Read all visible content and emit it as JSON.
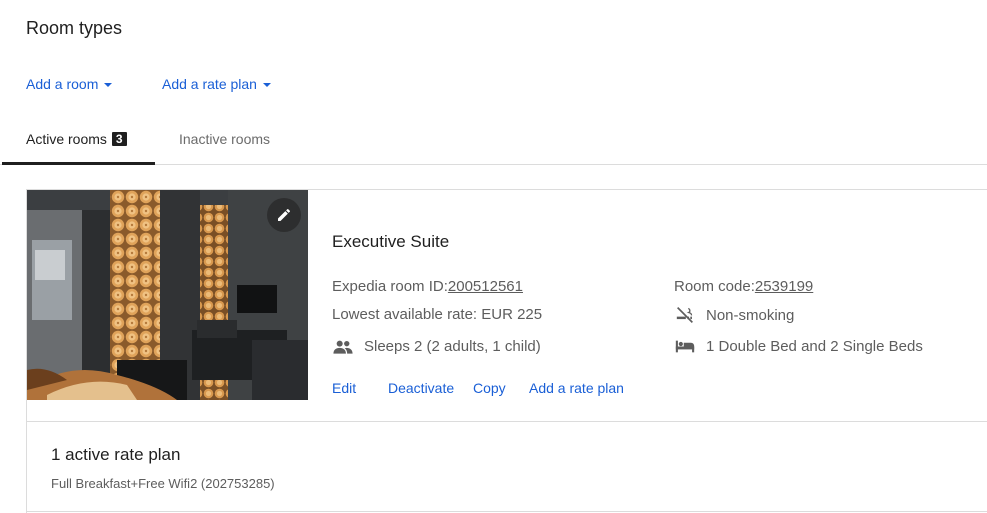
{
  "header": {
    "title": "Room types"
  },
  "actions": {
    "add_room": "Add a room",
    "add_rate_plan": "Add a rate plan"
  },
  "tabs": {
    "active": {
      "label": "Active rooms",
      "count": "3"
    },
    "inactive": {
      "label": "Inactive rooms"
    }
  },
  "room": {
    "name": "Executive Suite",
    "expedia_id_label": "Expedia room ID:",
    "expedia_id_value": " 200512561",
    "lowest_rate": "Lowest available rate: EUR 225",
    "sleeps": "Sleeps 2 (2 adults, 1 child)",
    "room_code_label": "Room code:",
    "room_code_value": " 2539199",
    "smoking": "Non-smoking",
    "beds": "1 Double Bed and 2 Single Beds",
    "links": {
      "edit": "Edit",
      "deactivate": "Deactivate",
      "copy": "Copy",
      "add_rate_plan": "Add a rate plan"
    },
    "icons": {
      "image_edit": "pencil-icon",
      "sleeps": "people-icon",
      "smoking": "no-smoking-icon",
      "beds": "bed-icon"
    }
  },
  "rate_plans": {
    "heading": "1 active rate plan",
    "items": [
      "Full Breakfast+Free Wifi2 (202753285)"
    ]
  },
  "colors": {
    "link": "#1a5fd6",
    "text": "#1f1f1f",
    "muted": "#5d5d5d",
    "border": "#dcdcdc"
  }
}
